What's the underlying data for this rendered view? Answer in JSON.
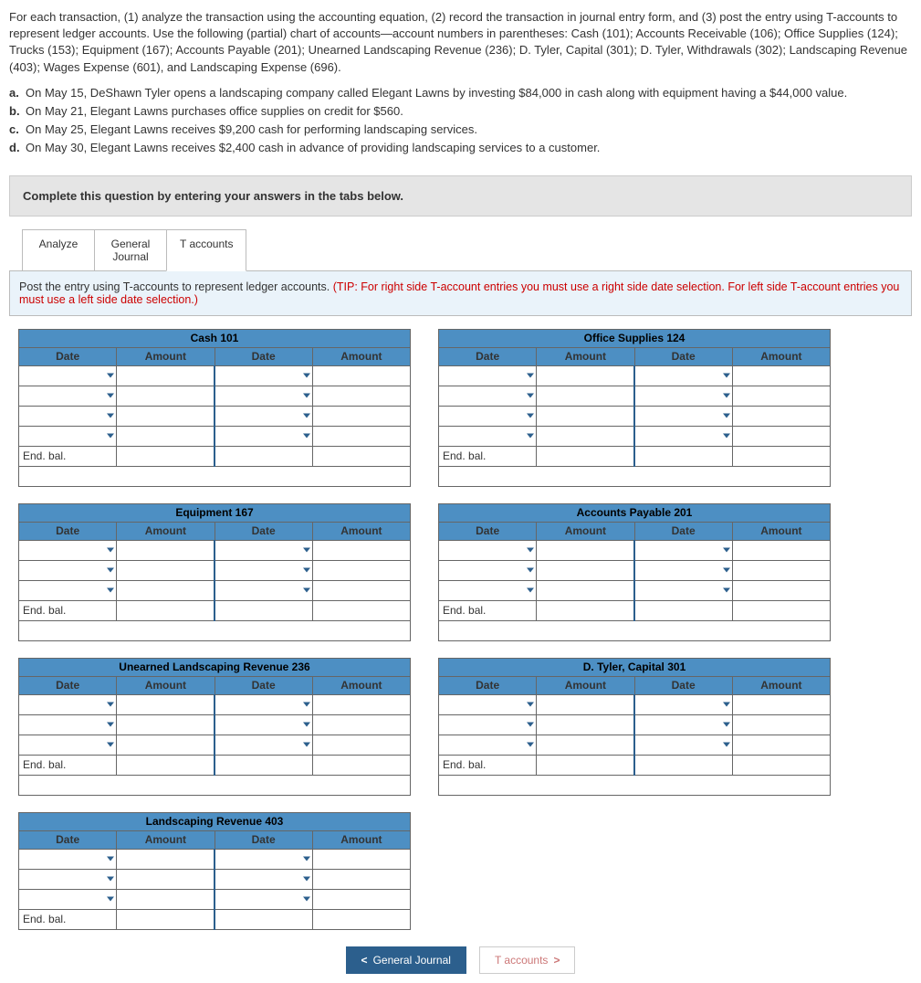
{
  "intro": "For each transaction, (1) analyze the transaction using the accounting equation, (2) record the transaction in journal entry form, and (3) post the entry using T-accounts to represent ledger accounts. Use the following (partial) chart of accounts—account numbers in parentheses: Cash (101); Accounts Receivable (106); Office Supplies (124); Trucks (153); Equipment (167); Accounts Payable (201); Unearned Landscaping Revenue (236); D. Tyler, Capital (301); D. Tyler, Withdrawals (302); Landscaping Revenue (403); Wages Expense (601), and Landscaping Expense (696).",
  "items": [
    {
      "letter": "a.",
      "text": "On May 15, DeShawn Tyler opens a landscaping company called Elegant Lawns by investing $84,000 in cash along with equipment having a $44,000 value."
    },
    {
      "letter": "b.",
      "text": "On May 21, Elegant Lawns purchases office supplies on credit for $560."
    },
    {
      "letter": "c.",
      "text": "On May 25, Elegant Lawns receives $9,200 cash for performing landscaping services."
    },
    {
      "letter": "d.",
      "text": "On May 30, Elegant Lawns receives $2,400 cash in advance of providing landscaping services to a customer."
    }
  ],
  "instruction": "Complete this question by entering your answers in the tabs below.",
  "tabs": {
    "analyze": "Analyze",
    "general_journal": "General\nJournal",
    "t_accounts": "T accounts"
  },
  "tip_prefix": "Post the entry using T-accounts to represent ledger accounts. ",
  "tip_red": "(TIP: For right side T-account entries you must use a right side date selection.  For left side T-account entries you must use a left side date selection.)",
  "hdr": {
    "date": "Date",
    "amount": "Amount"
  },
  "end_bal": "End. bal.",
  "accounts": {
    "cash": "Cash 101",
    "office_supplies": "Office Supplies 124",
    "equipment": "Equipment 167",
    "accounts_payable": "Accounts Payable 201",
    "unearned": "Unearned Landscaping Revenue 236",
    "capital": "D. Tyler, Capital 301",
    "landscaping_rev": "Landscaping Revenue 403"
  },
  "nav": {
    "prev_icon": "<",
    "prev": "General Journal",
    "next": "T accounts",
    "next_icon": ">"
  }
}
